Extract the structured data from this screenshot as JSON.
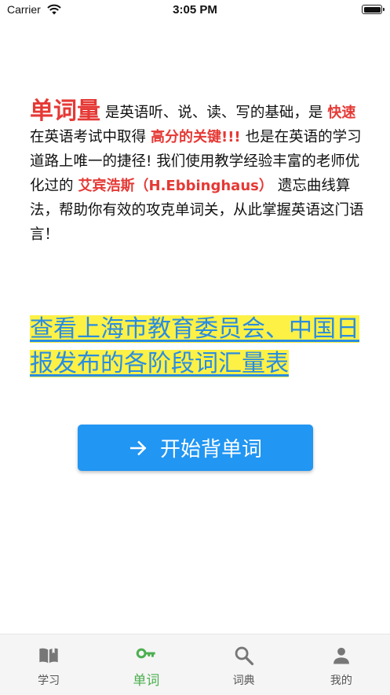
{
  "status_bar": {
    "carrier": "Carrier",
    "time": "3:05 PM"
  },
  "intro": {
    "highlight_word": "单词量",
    "part1": "是英语听、说、读、写的基础，是",
    "emphasis1": "快速",
    "part2": "在英语考试中取得",
    "emphasis2": "高分的关键!!!",
    "part3": "也是在英语的学习道路上唯一的捷径! 我们使用教学经验丰富的老师优化过的",
    "emphasis3": "艾宾浩斯（H.Ebbinghaus）",
    "part4": "遗忘曲线算法，帮助你有效的攻克单词关，从此掌握英语这门语言！"
  },
  "vocab_link": {
    "text": "查看上海市教育委员会、中国日报发布的各阶段词汇量表"
  },
  "start_button": {
    "label": "开始背单词",
    "icon": "arrow-right-icon"
  },
  "tabs": [
    {
      "label": "学习",
      "icon": "book-icon",
      "active": false
    },
    {
      "label": "单词",
      "icon": "key-icon",
      "active": true
    },
    {
      "label": "词典",
      "icon": "search-icon",
      "active": false
    },
    {
      "label": "我的",
      "icon": "person-icon",
      "active": false
    }
  ],
  "colors": {
    "accent_red": "#e53935",
    "link_blue": "#2a8ce0",
    "highlight_yellow": "#fdf146",
    "button_blue": "#2196f3",
    "tab_active_green": "#4caf50"
  }
}
